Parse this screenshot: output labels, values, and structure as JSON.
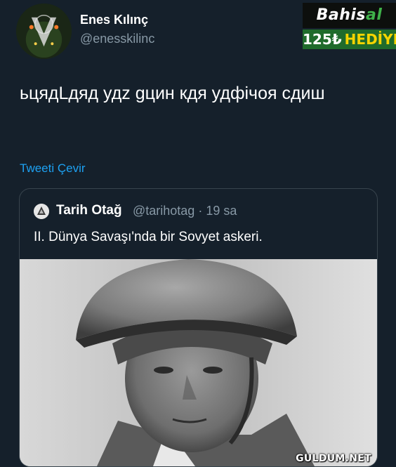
{
  "tweet": {
    "author_name": "Enes Kılınç",
    "author_handle": "@enesskilinc",
    "text": "ьцядLдяд удz gцин кдя удфічоя сдиш",
    "translate_link": "Tweeti Çevir"
  },
  "ad": {
    "brand_part1": "Bahis",
    "brand_part2": "al",
    "amount": "125₺",
    "gift": "HEDİYE"
  },
  "quoted_tweet": {
    "author_name": "Tarih Otağ",
    "meta": "@tarihotag · 19 sa",
    "text": "II. Dünya Savaşı'nda bir Sovyet askeri."
  },
  "watermark": "GULDUM.NET",
  "icons": {
    "author_avatar": "avatar-image",
    "quote_avatar": "avatar-image",
    "photo": "soldier-photo"
  }
}
